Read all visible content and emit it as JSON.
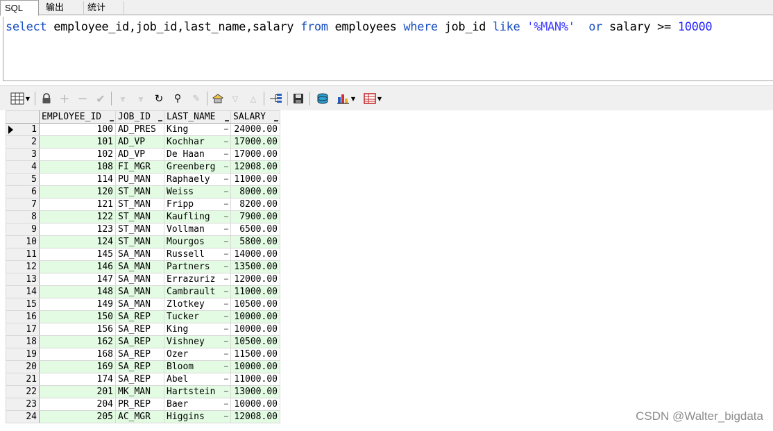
{
  "tabs": [
    {
      "label": "SQL",
      "active": true
    },
    {
      "label": "输出",
      "active": false
    },
    {
      "label": "统计",
      "active": false
    }
  ],
  "editor": {
    "tokens": [
      {
        "t": "select",
        "c": "kw"
      },
      {
        "t": " employee_id,job_id,last_name,salary ",
        "c": ""
      },
      {
        "t": "from",
        "c": "kw"
      },
      {
        "t": " employees ",
        "c": ""
      },
      {
        "t": "where",
        "c": "kw"
      },
      {
        "t": " job_id ",
        "c": ""
      },
      {
        "t": "like",
        "c": "kw"
      },
      {
        "t": " '%MAN%'",
        "c": "str"
      },
      {
        "t": "  ",
        "c": ""
      },
      {
        "t": "or",
        "c": "kw"
      },
      {
        "t": " salary >= ",
        "c": ""
      },
      {
        "t": "10000",
        "c": "num"
      }
    ]
  },
  "toolbar": {
    "icons": [
      "grid-options-icon",
      "lock-icon",
      "add-record-icon",
      "delete-record-icon",
      "post-edit-icon",
      "query-next-icon",
      "query-all-icon",
      "refresh-icon",
      "find-icon",
      "clear-icon",
      "single-record-icon",
      "sort-desc-icon",
      "sort-asc-icon",
      "query-tree-icon",
      "save-icon",
      "export-icon",
      "chart-icon",
      "table-view-icon"
    ]
  },
  "grid": {
    "columns": [
      "EMPLOYEE_ID",
      "JOB_ID",
      "LAST_NAME",
      "SALARY"
    ],
    "rows": [
      [
        "1",
        "100",
        "AD_PRES",
        "King",
        "24000.00"
      ],
      [
        "2",
        "101",
        "AD_VP",
        "Kochhar",
        "17000.00"
      ],
      [
        "3",
        "102",
        "AD_VP",
        "De Haan",
        "17000.00"
      ],
      [
        "4",
        "108",
        "FI_MGR",
        "Greenberg",
        "12008.00"
      ],
      [
        "5",
        "114",
        "PU_MAN",
        "Raphaely",
        "11000.00"
      ],
      [
        "6",
        "120",
        "ST_MAN",
        "Weiss",
        "8000.00"
      ],
      [
        "7",
        "121",
        "ST_MAN",
        "Fripp",
        "8200.00"
      ],
      [
        "8",
        "122",
        "ST_MAN",
        "Kaufling",
        "7900.00"
      ],
      [
        "9",
        "123",
        "ST_MAN",
        "Vollman",
        "6500.00"
      ],
      [
        "10",
        "124",
        "ST_MAN",
        "Mourgos",
        "5800.00"
      ],
      [
        "11",
        "145",
        "SA_MAN",
        "Russell",
        "14000.00"
      ],
      [
        "12",
        "146",
        "SA_MAN",
        "Partners",
        "13500.00"
      ],
      [
        "13",
        "147",
        "SA_MAN",
        "Errazuriz",
        "12000.00"
      ],
      [
        "14",
        "148",
        "SA_MAN",
        "Cambrault",
        "11000.00"
      ],
      [
        "15",
        "149",
        "SA_MAN",
        "Zlotkey",
        "10500.00"
      ],
      [
        "16",
        "150",
        "SA_REP",
        "Tucker",
        "10000.00"
      ],
      [
        "17",
        "156",
        "SA_REP",
        "King",
        "10000.00"
      ],
      [
        "18",
        "162",
        "SA_REP",
        "Vishney",
        "10500.00"
      ],
      [
        "19",
        "168",
        "SA_REP",
        "Ozer",
        "11500.00"
      ],
      [
        "20",
        "169",
        "SA_REP",
        "Bloom",
        "10000.00"
      ],
      [
        "21",
        "174",
        "SA_REP",
        "Abel",
        "11000.00"
      ],
      [
        "22",
        "201",
        "MK_MAN",
        "Hartstein",
        "13000.00"
      ],
      [
        "23",
        "204",
        "PR_REP",
        "Baer",
        "10000.00"
      ],
      [
        "24",
        "205",
        "AC_MGR",
        "Higgins",
        "12008.00"
      ]
    ],
    "ellipsis": "…"
  },
  "watermark": "CSDN @Walter_bigdata"
}
